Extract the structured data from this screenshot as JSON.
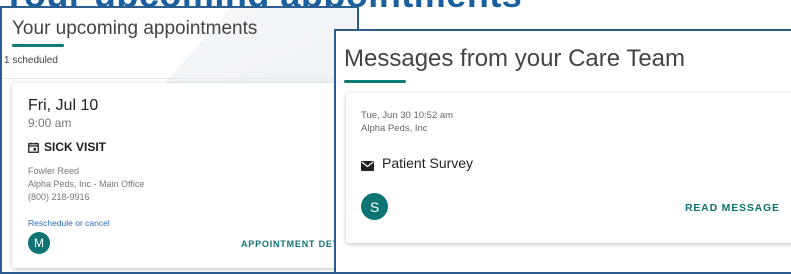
{
  "page": {
    "heading": "Your upcoming appointments"
  },
  "appointments": {
    "title": "Your upcoming appointments",
    "count_text": "1 scheduled",
    "items": [
      {
        "date": "Fri, Jul 10",
        "time": "9:00 am",
        "type": "SICK VISIT",
        "type_icon": "calendar-icon",
        "provider": "Fowler Reed",
        "location": "Alpha Peds, Inc - Main Office",
        "phone": "(800) 218-9916",
        "reschedule_label": "Reschedule or cancel",
        "avatar_initial": "M",
        "detail_label": "APPOINTMENT DETAILS"
      }
    ]
  },
  "messages": {
    "title": "Messages from your Care Team",
    "items": [
      {
        "datetime": "Tue, Jun 30 10:52 am",
        "organization": "Alpha Peds, Inc",
        "subject": "Patient Survey",
        "subject_icon": "envelope-icon",
        "avatar_initial": "S",
        "read_label": "READ MESSAGE"
      }
    ]
  },
  "colors": {
    "accent_teal": "#0e7373",
    "card_border": "#2b5d8e",
    "link_blue": "#2a6db5",
    "heading_blue": "#1a5f9e"
  }
}
